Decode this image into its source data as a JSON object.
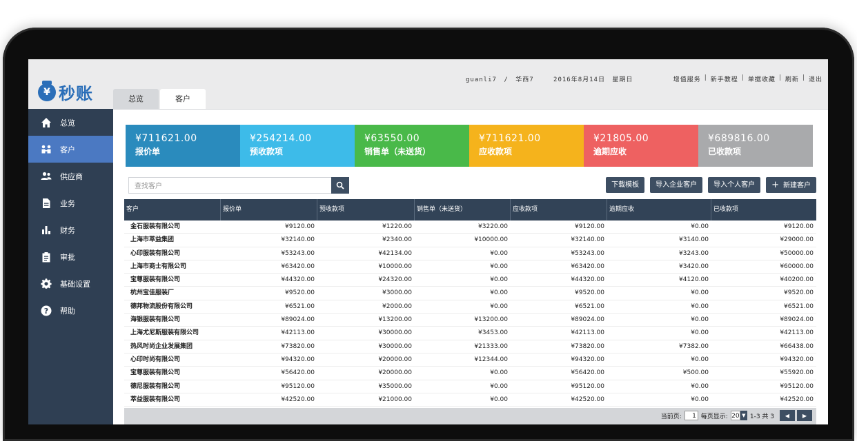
{
  "app": {
    "logo_glyph": "¥",
    "name": "秒账"
  },
  "tabs": [
    "总览",
    "客户"
  ],
  "header": {
    "user": "guanli7",
    "region": "华西7",
    "date": "2016年8月14日",
    "weekday": "星期日",
    "links": [
      "增值服务",
      "新手教程",
      "单据收藏",
      "刷新",
      "退出"
    ]
  },
  "sidebar": {
    "items": [
      {
        "label": "总览",
        "icon": "home-icon"
      },
      {
        "label": "客户",
        "icon": "customer-icon"
      },
      {
        "label": "供应商",
        "icon": "supplier-icon"
      },
      {
        "label": "业务",
        "icon": "document-icon"
      },
      {
        "label": "财务",
        "icon": "bar-chart-icon"
      },
      {
        "label": "审批",
        "icon": "clipboard-icon"
      },
      {
        "label": "基础设置",
        "icon": "gear-icon"
      },
      {
        "label": "帮助",
        "icon": "help-icon"
      }
    ]
  },
  "summary": [
    {
      "amount": "¥711621.00",
      "label": "报价单",
      "color": "#2a8bbd"
    },
    {
      "amount": "¥254214.00",
      "label": "预收款项",
      "color": "#3dbbe9"
    },
    {
      "amount": "¥63550.00",
      "label": "销售单（未送货）",
      "color": "#49b949"
    },
    {
      "amount": "¥711621.00",
      "label": "应收款项",
      "color": "#f5b31c"
    },
    {
      "amount": "¥21805.00",
      "label": "逾期应收",
      "color": "#ee6161"
    },
    {
      "amount": "¥689816.00",
      "label": "已收款项",
      "color": "#a9aaac"
    }
  ],
  "search": {
    "placeholder": "查找客户"
  },
  "actions": {
    "download_template": "下载模板",
    "import_company": "导入企业客户",
    "import_personal": "导入个人客户",
    "new_customer": "新建客户"
  },
  "table": {
    "columns": [
      "客户",
      "报价单",
      "预收款项",
      "销售单（未送货）",
      "应收款项",
      "逾期应收",
      "已收款项"
    ],
    "rows": [
      [
        "金石服装有限公司",
        "¥9120.00",
        "¥1220.00",
        "¥3220.00",
        "¥9120.00",
        "¥0.00",
        "¥9120.00"
      ],
      [
        "上海市萃益集团",
        "¥32140.00",
        "¥2340.00",
        "¥10000.00",
        "¥32140.00",
        "¥3140.00",
        "¥29000.00"
      ],
      [
        "心印服装有限公司",
        "¥53243.00",
        "¥42134.00",
        "¥0.00",
        "¥53243.00",
        "¥3243.00",
        "¥50000.00"
      ],
      [
        "上海市商士有限公司",
        "¥63420.00",
        "¥10000.00",
        "¥0.00",
        "¥63420.00",
        "¥3420.00",
        "¥60000.00"
      ],
      [
        "宝尊服装有限公司",
        "¥44320.00",
        "¥24320.00",
        "¥0.00",
        "¥44320.00",
        "¥4120.00",
        "¥40200.00"
      ],
      [
        "杭州宝佳服装厂",
        "¥9520.00",
        "¥3000.00",
        "¥0.00",
        "¥9520.00",
        "¥0.00",
        "¥9520.00"
      ],
      [
        "德邦物流股份有限公司",
        "¥6521.00",
        "¥2000.00",
        "¥0.00",
        "¥6521.00",
        "¥0.00",
        "¥6521.00"
      ],
      [
        "海银服装有限公司",
        "¥89024.00",
        "¥13200.00",
        "¥13200.00",
        "¥89024.00",
        "¥0.00",
        "¥89024.00"
      ],
      [
        "上海尤尼斯服装有限公司",
        "¥42113.00",
        "¥30000.00",
        "¥3453.00",
        "¥42113.00",
        "¥0.00",
        "¥42113.00"
      ],
      [
        "热风时尚企业发展集团",
        "¥73820.00",
        "¥30000.00",
        "¥21333.00",
        "¥73820.00",
        "¥7382.00",
        "¥66438.00"
      ],
      [
        "心印时尚有限公司",
        "¥94320.00",
        "¥20000.00",
        "¥12344.00",
        "¥94320.00",
        "¥0.00",
        "¥94320.00"
      ],
      [
        "宝尊服装有限公司",
        "¥56420.00",
        "¥20000.00",
        "¥0.00",
        "¥56420.00",
        "¥500.00",
        "¥55920.00"
      ],
      [
        "德尼服装有限公司",
        "¥95120.00",
        "¥35000.00",
        "¥0.00",
        "¥95120.00",
        "¥0.00",
        "¥95120.00"
      ],
      [
        "萃益服装有限公司",
        "¥42520.00",
        "¥21000.00",
        "¥0.00",
        "¥42520.00",
        "¥0.00",
        "¥42520.00"
      ]
    ]
  },
  "pager": {
    "current_label": "当前页:",
    "current_page": "1",
    "per_page_label": "每页显示:",
    "per_page": "20",
    "range": "1-3 共 3",
    "prev_icon": "prev-page-icon",
    "next_icon": "next-page-icon"
  }
}
